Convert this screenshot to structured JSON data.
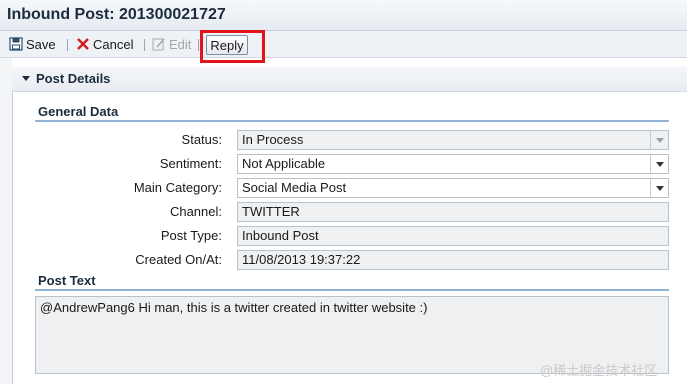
{
  "window": {
    "title": "Inbound Post: 201300021727"
  },
  "toolbar": {
    "save_label": "Save",
    "cancel_label": "Cancel",
    "edit_label": "Edit",
    "reply_label": "Reply",
    "highlight_color": "#e0141a"
  },
  "section": {
    "title": "Post Details",
    "expanded": true
  },
  "general_data": {
    "title": "General Data",
    "fields": [
      {
        "label": "Status:",
        "value": "In Process",
        "kind": "select-disabled"
      },
      {
        "label": "Sentiment:",
        "value": "Not Applicable",
        "kind": "select"
      },
      {
        "label": "Main Category:",
        "value": "Social Media Post",
        "kind": "select"
      },
      {
        "label": "Channel:",
        "value": "TWITTER",
        "kind": "readonly"
      },
      {
        "label": "Post Type:",
        "value": "Inbound Post",
        "kind": "readonly"
      },
      {
        "label": "Created On/At:",
        "value": "11/08/2013 19:37:22",
        "kind": "readonly"
      }
    ]
  },
  "post_text": {
    "title": "Post Text",
    "content": "@AndrewPang6  Hi man, this is a twitter created in twitter website :)"
  },
  "watermark": "@稀土掘金技术社区",
  "icons": {
    "save": "floppy-disk-icon",
    "cancel": "red-x-icon",
    "edit": "pencil-icon",
    "section_toggle": "caret-down-icon",
    "dropdown": "chevron-down-icon"
  }
}
